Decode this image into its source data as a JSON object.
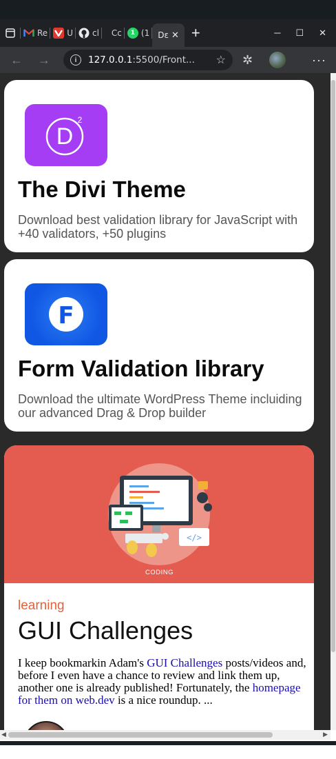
{
  "browser": {
    "tabs": [
      {
        "label": "Re",
        "icon": "gmail-icon"
      },
      {
        "label": "U",
        "icon": "vivaldi-icon"
      },
      {
        "label": "cl",
        "icon": "github-icon"
      },
      {
        "label": "Cc",
        "icon": "page-icon"
      },
      {
        "label": "(1",
        "icon": "whatsapp-icon",
        "badge": "1"
      },
      {
        "label": "Dε",
        "icon": "page-icon",
        "active": true
      }
    ],
    "close_glyph": "✕",
    "new_tab_glyph": "+",
    "url_host": "127.0.0.1",
    "url_rest": ":5500/Front..."
  },
  "cards": [
    {
      "logo_letter": "D",
      "logo_sup": "2",
      "title": "The Divi Theme",
      "description": "Download best validation library for JavaScript with +40 validators, +50 plugins"
    },
    {
      "logo_letter": "F",
      "title": "Form Validation library",
      "description": "Download the ultimate WordPress Theme incluiding our advanced Drag & Drop builder"
    }
  ],
  "post": {
    "image_caption": "CODING",
    "category": "learning",
    "title": "GUI Challenges",
    "body_1": "I keep bookmarkin Adam's ",
    "link_1": "GUI Challenges",
    "body_2": " posts/videos and, before I even have a chance to review and link them up, another one is already published! Fortunately, the ",
    "link_2": "homepage for them on web.dev",
    "body_3": " is a nice roundup. ..."
  },
  "colors": {
    "divi_purple": "#a43df4",
    "formv_blue": "#1057e4",
    "hero_red": "#e45c4f",
    "category_orange": "#e0623d",
    "link_blue": "#1a0dab"
  }
}
